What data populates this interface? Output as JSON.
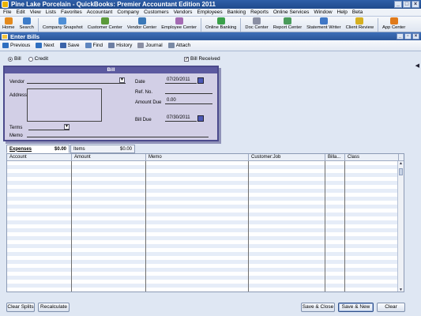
{
  "window": {
    "title": "Pine Lake Porcelain  - QuickBooks: Premier Accountant Edition 2011"
  },
  "menu": [
    "File",
    "Edit",
    "View",
    "Lists",
    "Favorites",
    "Accountant",
    "Company",
    "Customers",
    "Vendors",
    "Employees",
    "Banking",
    "Reports",
    "Online Services",
    "Window",
    "Help",
    "Beta"
  ],
  "toolbar": [
    {
      "label": "Home",
      "icon": "home-icon",
      "color": "#e48a1d"
    },
    {
      "label": "Search",
      "icon": "search-icon",
      "color": "#3d7cc9"
    },
    {
      "label": "Company Snapshot",
      "icon": "snapshot-icon",
      "color": "#4f8fd6"
    },
    {
      "label": "Customer Center",
      "icon": "customer-icon",
      "color": "#5b9a3a"
    },
    {
      "label": "Vendor Center",
      "icon": "vendor-icon",
      "color": "#3b79b8"
    },
    {
      "label": "Employee Center",
      "icon": "employee-icon",
      "color": "#a46bb3"
    },
    {
      "label": "Online Banking",
      "icon": "banking-icon",
      "color": "#3aa04a"
    },
    {
      "label": "Doc Center",
      "icon": "doc-icon",
      "color": "#8a8fa3"
    },
    {
      "label": "Report Center",
      "icon": "report-icon",
      "color": "#4a9b5b"
    },
    {
      "label": "Statement Writer",
      "icon": "statement-icon",
      "color": "#3f77c6"
    },
    {
      "label": "Client Review",
      "icon": "review-icon",
      "color": "#d6b020"
    },
    {
      "label": "App Center",
      "icon": "app-icon",
      "color": "#e07a1a"
    }
  ],
  "form": {
    "title": "Enter Bills",
    "actions": [
      {
        "label": "Previous",
        "icon": "previous-icon",
        "color": "#2f6fc0"
      },
      {
        "label": "Next",
        "icon": "next-icon",
        "color": "#2f6fc0"
      },
      {
        "label": "Save",
        "icon": "save-icon",
        "color": "#3a63a8"
      },
      {
        "label": "Find",
        "icon": "find-icon",
        "color": "#5f86bf"
      },
      {
        "label": "History",
        "icon": "history-icon",
        "color": "#6d7fa3"
      },
      {
        "label": "Journal",
        "icon": "journal-icon",
        "color": "#8a8fa3"
      },
      {
        "label": "Attach",
        "icon": "attach-icon",
        "color": "#7a8aa5"
      }
    ],
    "type_bill": "Bill",
    "type_credit": "Credit",
    "bill_received": "Bill Received",
    "bill_received_check": "✓"
  },
  "bill": {
    "header": "Bill",
    "vendor_label": "Vendor",
    "address_label": "Address",
    "terms_label": "Terms",
    "memo_label": "Memo",
    "date_label": "Date",
    "date_value": "07/20/2011",
    "ref_label": "Ref. No.",
    "amount_due_label": "Amount Due",
    "amount_due_value": "0.00",
    "bill_due_label": "Bill Due",
    "bill_due_value": "07/30/2011"
  },
  "tabs": {
    "expenses_label": "Expenses",
    "expenses_amount": "$0.00",
    "items_label": "Items",
    "items_amount": "$0.00"
  },
  "grid": {
    "columns": [
      "Account",
      "Amount",
      "Memo",
      "Customer:Job",
      "Billa...",
      "Class"
    ]
  },
  "buttons": {
    "clear_splits": "Clear Splits",
    "recalculate": "Recalculate",
    "save_close": "Save & Close",
    "save_new": "Save & New",
    "clear": "Clear"
  }
}
